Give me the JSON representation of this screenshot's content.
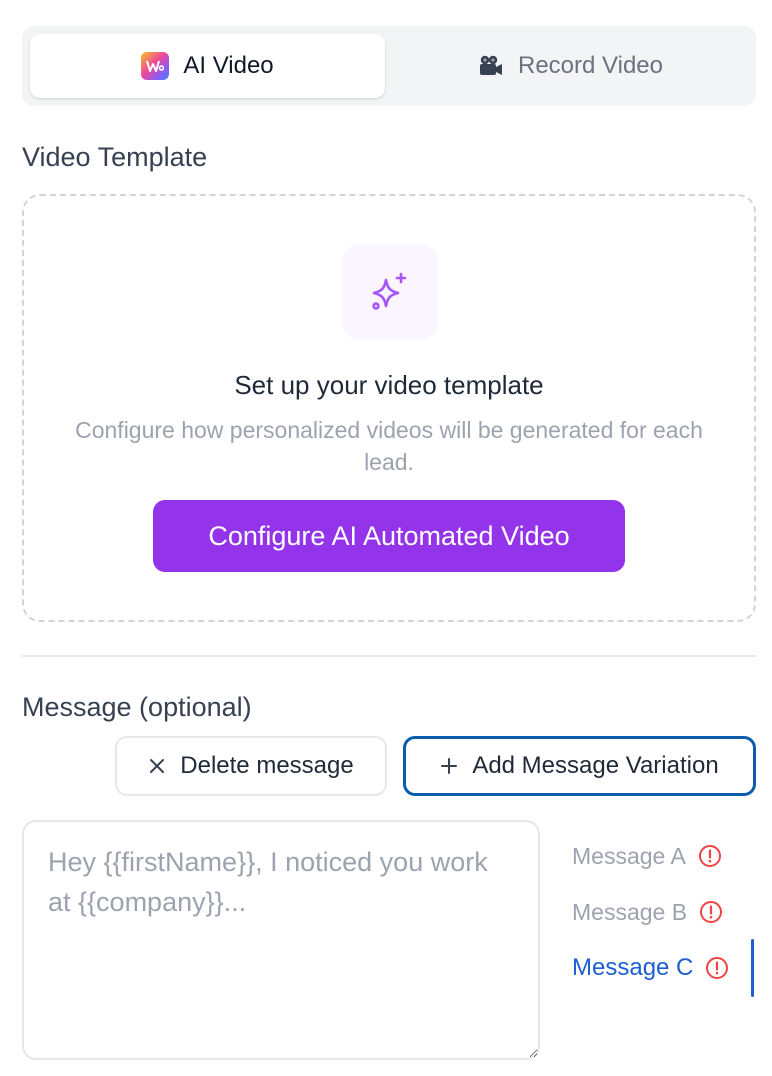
{
  "tabs": {
    "ai_video": "AI Video",
    "record_video": "Record Video",
    "ai_icon": "app-logo-icon",
    "record_icon": "video-camera-icon"
  },
  "template": {
    "section_title": "Video Template",
    "icon": "sparkle-icon",
    "heading": "Set up your video template",
    "description": "Configure how personalized videos will be generated for each lead.",
    "button_label": "Configure AI Automated Video"
  },
  "message": {
    "section_title": "Message (optional)",
    "delete_label": "Delete message",
    "add_label": "Add Message Variation",
    "placeholder": "Hey {{firstName}}, I noticed you work at {{company}}...",
    "value": "",
    "variations": [
      {
        "label": "Message A",
        "status_icon": "warning-circle-icon",
        "active": false
      },
      {
        "label": "Message B",
        "status_icon": "warning-circle-icon",
        "active": false
      },
      {
        "label": "Message C",
        "status_icon": "warning-circle-icon",
        "active": true
      }
    ]
  },
  "colors": {
    "accent_purple": "#9333ea",
    "active_blue": "#1d5fd1",
    "focus_border": "#0b5cad",
    "warning_red": "#ef4444"
  }
}
